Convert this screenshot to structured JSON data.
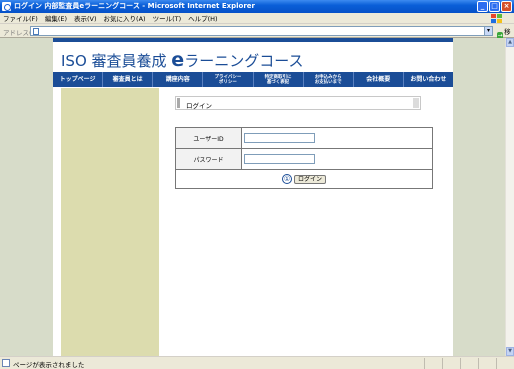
{
  "window": {
    "title": "ログイン 内部監査員eラーニングコース - Microsoft Internet Explorer"
  },
  "menu": {
    "items": [
      "ファイル(F)",
      "編集(E)",
      "表示(V)",
      "お気に入り(A)",
      "ツール(T)",
      "ヘルプ(H)"
    ]
  },
  "address": {
    "label": "アドレス(D)",
    "value": "",
    "go_label": "移動"
  },
  "site": {
    "title_prefix": "ISO 審査員養成 ",
    "title_e": "e",
    "title_suffix": "ラーニングコース"
  },
  "nav": {
    "items": [
      "トップページ",
      "審査員とは",
      "講座内容",
      "プライバシー\nポリシー",
      "特定商取引に\n基づく表記",
      "お申込みから\nお支払いまで",
      "会社概要",
      "お問い合わせ"
    ]
  },
  "login": {
    "heading": "ログイン",
    "user_label": "ユーザーID",
    "user_value": "",
    "password_label": "パスワード",
    "password_value": "",
    "step_marker": "①",
    "button_label": "ログイン"
  },
  "status": {
    "text": "ページが表示されました"
  },
  "colors": {
    "brand": "#1b4d97",
    "sidebar": "#dcdcae",
    "window_bg": "#d7dcc9"
  }
}
